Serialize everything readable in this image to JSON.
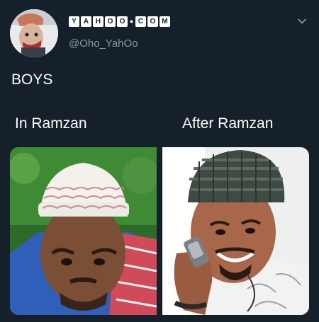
{
  "tweet": {
    "display_name_letters": [
      "Y",
      "A",
      "H",
      "O",
      "O",
      "C",
      "O",
      "M"
    ],
    "display_name_separator": "•",
    "handle": "@Oho_YahOo",
    "text": "BOYS",
    "menu_icon": "chevron-down-icon"
  },
  "meme": {
    "left_caption": "In Ramzan",
    "right_caption": "After Ramzan"
  },
  "colors": {
    "background": "#15202b",
    "text": "#ffffff",
    "secondary_text": "#8899a6"
  }
}
